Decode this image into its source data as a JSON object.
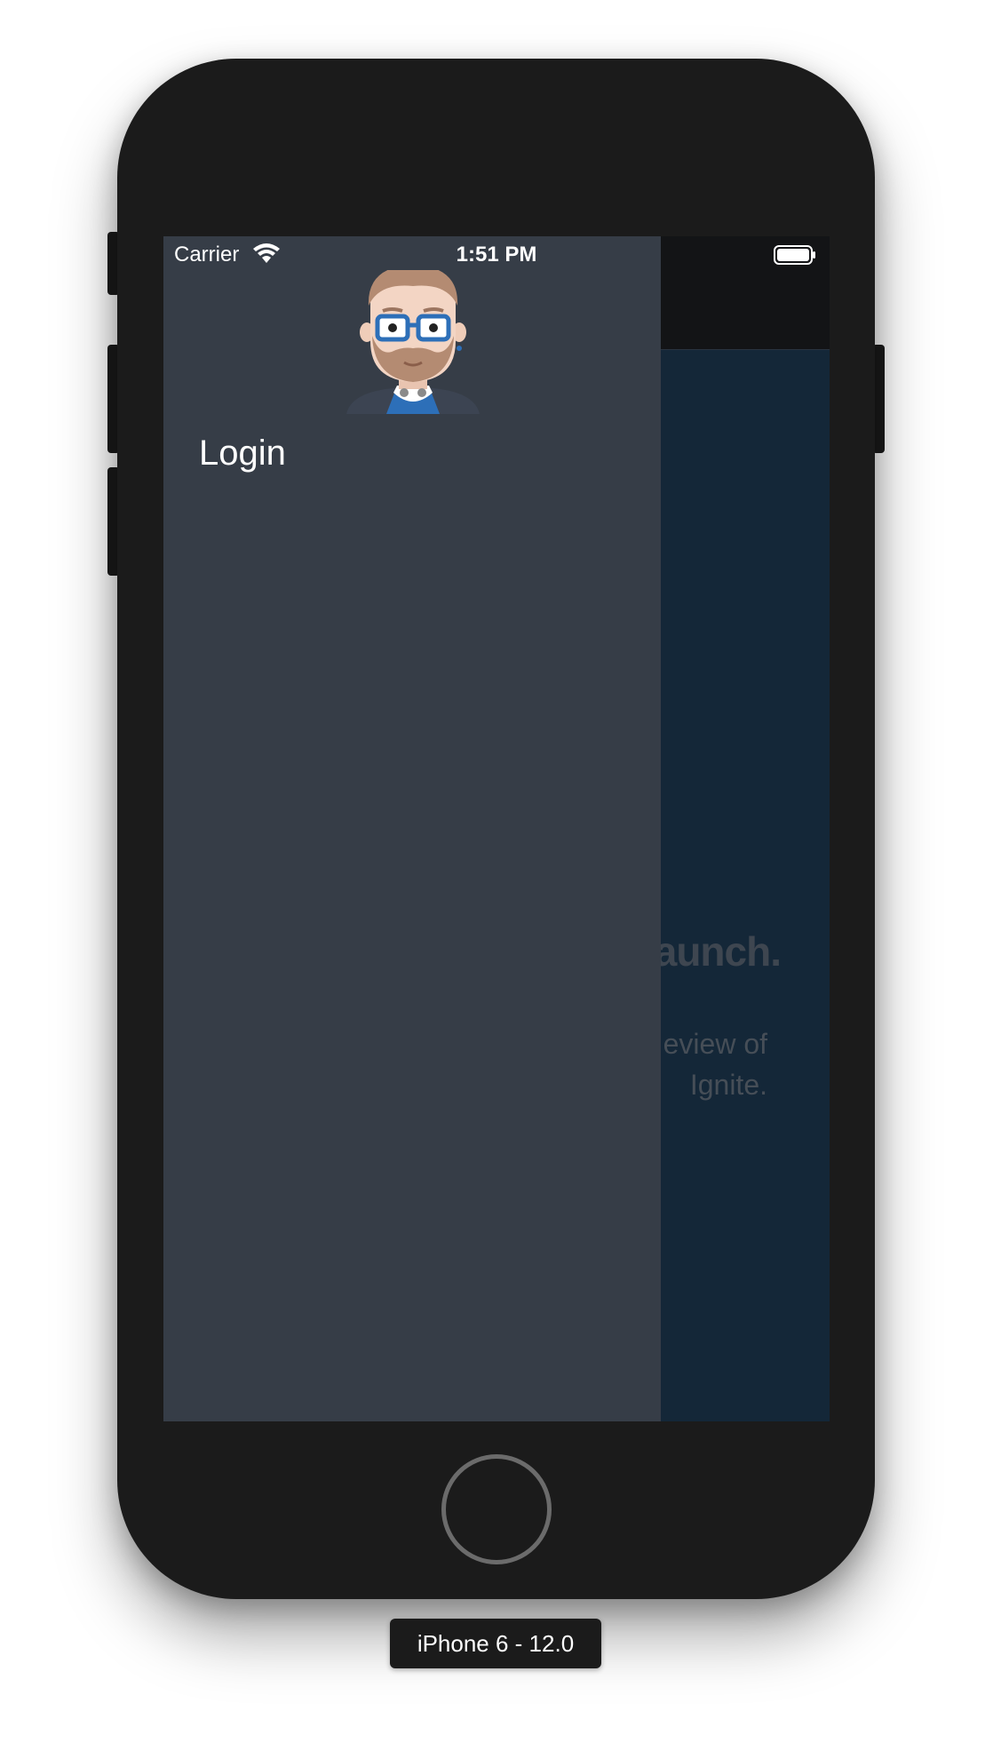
{
  "status_bar": {
    "carrier": "Carrier",
    "time": "1:51 PM"
  },
  "drawer": {
    "menu_items": [
      {
        "label": "Login"
      }
    ]
  },
  "background_screen": {
    "headline_partial": "aunch.",
    "body_partial_line1": "eview of",
    "body_partial_line2": "Ignite."
  },
  "device": {
    "label": "iPhone 6 - 12.0"
  },
  "colors": {
    "drawer_bg": "#363d47",
    "screen_bg": "#142738",
    "nav_bg": "#131416",
    "phone_body": "#1b1b1b"
  },
  "icons": {
    "wifi": "wifi-icon",
    "battery": "battery-icon",
    "avatar": "avatar"
  }
}
